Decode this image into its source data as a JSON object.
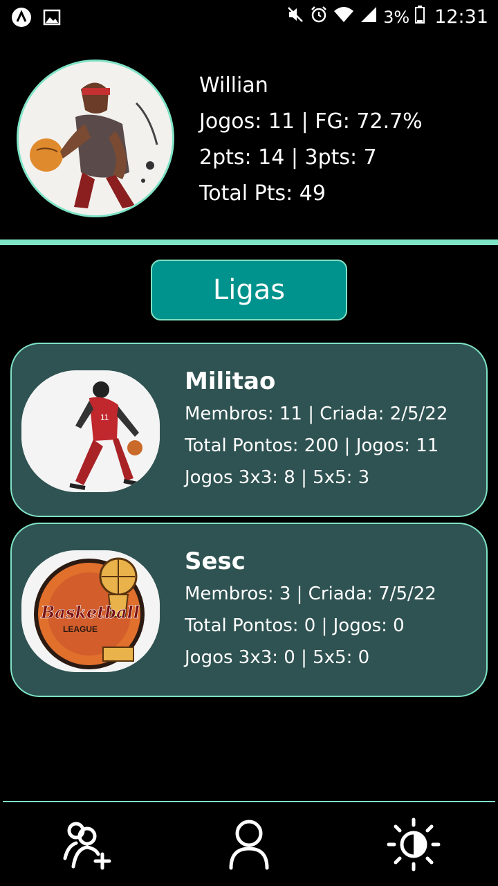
{
  "status_bar": {
    "battery_percent": "3%",
    "time": "12:31",
    "icons": [
      "app-icon",
      "image-icon",
      "mute-icon",
      "alarm-icon",
      "wifi-icon",
      "signal-icon",
      "battery-icon"
    ]
  },
  "profile": {
    "name": "Willian",
    "line1": "Jogos: 11 | FG: 72.7%",
    "line2": "2pts: 14 | 3pts: 7",
    "line3": "Total Pts: 49"
  },
  "ligas_button": "Ligas",
  "leagues": [
    {
      "name": "Militao",
      "line1": "Membros: 11 | Criada: 2/5/22",
      "line2": "Total Pontos: 200 | Jogos: 11",
      "line3": "Jogos 3x3: 8 | 5x5: 3"
    },
    {
      "name": "Sesc",
      "line1": "Membros: 3 | Criada: 7/5/22",
      "line2": "Total Pontos: 0 | Jogos: 0",
      "line3": "Jogos 3x3: 0 | 5x5: 0",
      "logo_text": "Basketball",
      "logo_subtext": "LEAGUE"
    }
  ],
  "tabbar": {
    "icons": [
      "add-user-icon",
      "profile-icon",
      "theme-toggle-icon"
    ]
  },
  "colors": {
    "accent": "#7fe3c6",
    "button": "#00928c",
    "card": "#2f5352",
    "background": "#000000"
  }
}
